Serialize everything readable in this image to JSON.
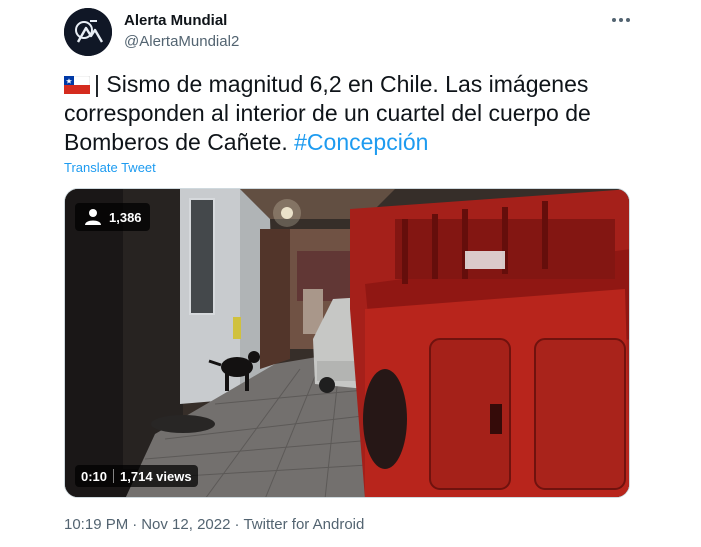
{
  "author": {
    "name": "Alerta Mundial",
    "handle": "@AlertaMundial2",
    "avatar_icon": "alerta-mundial-logo"
  },
  "tweet": {
    "flag_icon": "chile-flag-icon",
    "line1": "| Sismo de magnitud 6,2 en Chile. Las imágenes",
    "line2": "corresponden al interior de un cuartel del cuerpo de",
    "line3_text": "Bomberos de Cañete.",
    "hashtag": "#Concepción",
    "translate_label": "Translate Tweet"
  },
  "video": {
    "live_viewers": "1,386",
    "timestamp": "0:10",
    "views": "1,714 views"
  },
  "meta": {
    "time": "10:19 PM",
    "date": "Nov 12, 2022",
    "source": "Twitter for Android"
  },
  "colors": {
    "link": "#1d9bf0",
    "secondary_text": "#536471",
    "primary_text": "#0f1419"
  }
}
